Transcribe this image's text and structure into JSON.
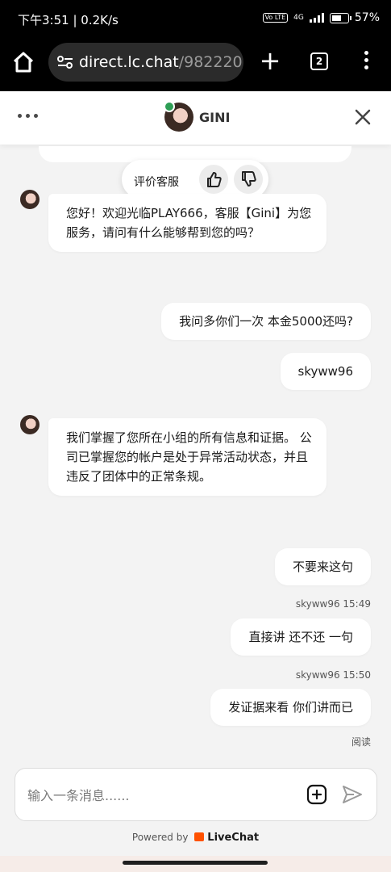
{
  "status_bar": {
    "time": "下午3:51 | 0.2K/s",
    "volte": "Vo LTE",
    "network": "4G",
    "battery": "57%"
  },
  "browser": {
    "url_host": "direct.lc.chat",
    "url_path": "/982220!",
    "tab_count": "2"
  },
  "chat_header": {
    "agent_name": "GINI"
  },
  "rating": {
    "label": "评价客服"
  },
  "messages": [
    {
      "from": "agent",
      "text": "您好！欢迎光临PLAY666，客服【Gini】为您服务，请问有什么能够帮到您的吗？"
    },
    {
      "from": "visitor",
      "text": "我问多你们一次 本金5000还吗?"
    },
    {
      "from": "visitor",
      "text": "skyww96"
    },
    {
      "from": "agent",
      "text": "我们掌握了您所在小组的所有信息和证据。 公司已掌握您的帐户是处于异常活动状态，并且违反了团体中的正常条规。"
    },
    {
      "from": "visitor",
      "text": "不要来这句",
      "meta": "skyww96 15:49"
    },
    {
      "from": "visitor",
      "text": "直接讲 还不还 一句",
      "meta": "skyww96 15:50"
    },
    {
      "from": "visitor",
      "text": "发证据来看 你们讲而已",
      "meta": "阅读"
    }
  ],
  "composer": {
    "placeholder": "输入一条消息......"
  },
  "footer": {
    "powered_by": "Powered by",
    "brand": "LiveChat"
  }
}
